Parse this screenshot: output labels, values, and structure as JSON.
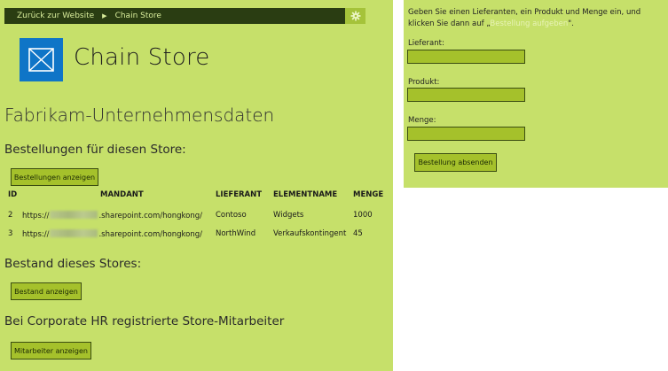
{
  "header": {
    "back_link": "Zurück zur Website",
    "breadcrumb_current": "Chain Store"
  },
  "app": {
    "title": "Chain Store"
  },
  "page": {
    "heading": "Fabrikam-Unternehmensdaten",
    "orders_heading": "Bestellungen für diesen Store:",
    "orders_button": "Bestellungen anzeigen",
    "inventory_heading": "Bestand dieses Stores:",
    "inventory_button": "Bestand anzeigen",
    "employees_heading": "Bei Corporate HR registrierte Store-Mitarbeiter",
    "employees_button": "Mitarbeiter anzeigen"
  },
  "orders_table": {
    "columns": [
      "ID",
      "MANDANT",
      "LIEFERANT",
      "ELEMENTNAME",
      "MENGE"
    ],
    "rows": [
      {
        "id": "2",
        "tenant_prefix": "https://",
        "tenant_suffix": ".sharepoint.com/hongkong/",
        "supplier": "Contoso",
        "item": "Widgets",
        "quantity": "1000"
      },
      {
        "id": "3",
        "tenant_prefix": "https://",
        "tenant_suffix": ".sharepoint.com/hongkong/",
        "supplier": "NorthWind",
        "item": "Verkaufskontingent",
        "quantity": "45"
      }
    ]
  },
  "order_form": {
    "instructions_before": "Geben Sie einen Lieferanten, ein Produkt und Menge ein, und klicken Sie dann auf „",
    "instructions_link": "Bestellung aufgeben",
    "instructions_after": "\".",
    "supplier_label": "Lieferant:",
    "supplier_value": "",
    "product_label": "Produkt:",
    "product_value": "",
    "quantity_label": "Menge:",
    "quantity_value": "",
    "submit_button": "Bestellung absenden"
  },
  "icons": {
    "settings": "gear-icon",
    "logo": "envelope-icon",
    "breadcrumb_separator": "triangle-right-icon"
  },
  "colors": {
    "background": "#c6e06a",
    "topbar": "#2a3d12",
    "logo": "#0f75c7",
    "button": "#a5c12b",
    "gear_box": "#a5c33a"
  }
}
